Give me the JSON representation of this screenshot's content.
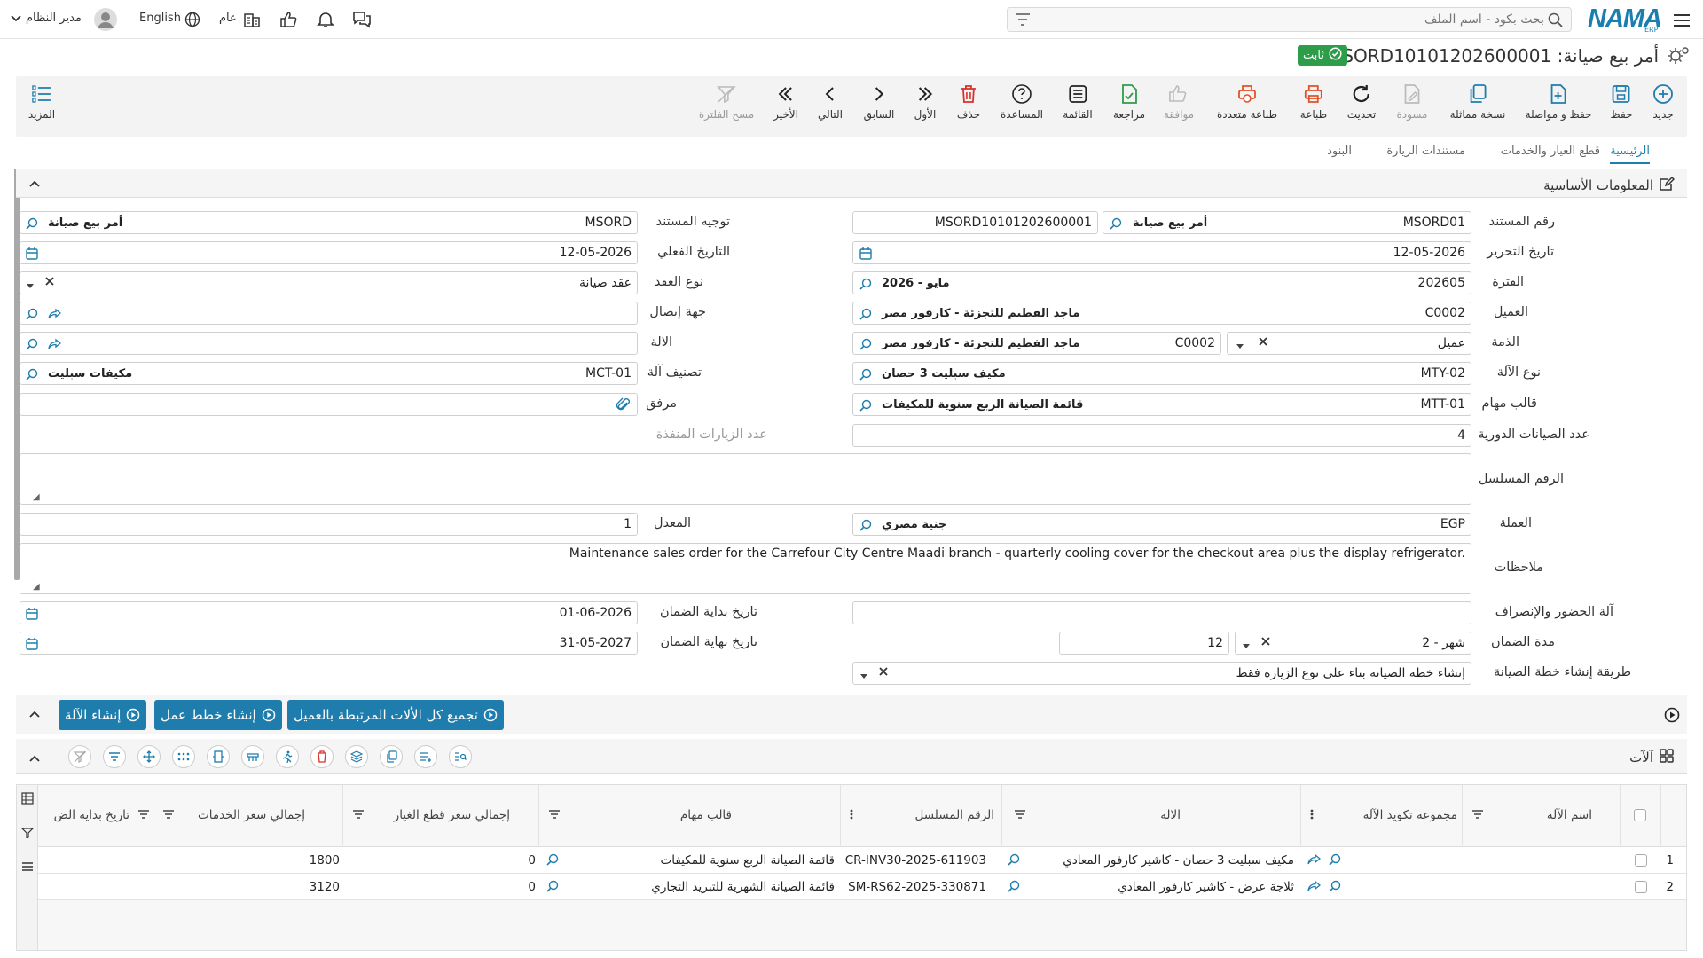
{
  "topbar": {
    "search_placeholder": "بحث بكود - اسم الملف",
    "user_name": "مدير النظام",
    "language": "English",
    "scope": "عام",
    "brand": "NAMA",
    "brand_sub": "ERP"
  },
  "page": {
    "title": "أمر بيع صيانة: MSORD10101202600001",
    "status": "ثابت"
  },
  "toolbar": {
    "new": "جديد",
    "save": "حفظ",
    "save_continue": "حفظ و مواصلة",
    "copy_similar": "نسخة مماثلة",
    "draft": "مسودة",
    "refresh": "تحديث",
    "print": "طباعة",
    "multi_print": "طباعة متعددة",
    "approve": "موافقة",
    "review": "مراجعة",
    "list": "القائمة",
    "help": "المساعدة",
    "delete": "حذف",
    "first": "الأول",
    "previous": "السابق",
    "next": "التالي",
    "last": "الأخير",
    "clear_filter": "مسح الفلترة",
    "more": "المزيد"
  },
  "tabs": [
    "الرئيسية",
    "قطع الغيار والخدمات",
    "مستندات الزيارة",
    "البنود"
  ],
  "section_basic": "المعلومات الأساسية",
  "fields": {
    "doc_number": {
      "label": "رقم المستند",
      "code": "MSORD01",
      "name": "أمر بيع صيانة",
      "value": "MSORD10101202600001"
    },
    "doc_direction": {
      "label": "توجيه المستند",
      "code": "MSORD",
      "name": "أمر بيع صيانة"
    },
    "issue_date": {
      "label": "تاريخ التحرير",
      "value": "12-05-2026"
    },
    "actual_date": {
      "label": "التاريخ الفعلي",
      "value": "12-05-2026"
    },
    "period": {
      "label": "الفترة",
      "code": "202605",
      "name": "2026 - مايو"
    },
    "contract_type": {
      "label": "نوع العقد",
      "value": "عقد صيانة"
    },
    "customer": {
      "label": "العميل",
      "code": "C0002",
      "name": "ماجد الفطيم للتجزئة - كارفور مصر"
    },
    "contact": {
      "label": "جهة إتصال",
      "value": ""
    },
    "account": {
      "label": "الذمة",
      "type": "عميل",
      "code": "C0002",
      "name": "ماجد الفطيم للتجزئة - كارفور مصر"
    },
    "machine": {
      "label": "الالة",
      "value": ""
    },
    "machine_type": {
      "label": "نوع الآلة",
      "code": "MTY-02",
      "name": "مكيف سبليت 3 حصان"
    },
    "machine_class": {
      "label": "تصنيف آلة",
      "code": "MCT-01",
      "name": "مكيفات سبليت"
    },
    "task_template": {
      "label": "قالب مهام",
      "code": "MTT-01",
      "name": "قائمة الصيانة الربع سنوية للمكيفات"
    },
    "attachment": {
      "label": "مرفق",
      "value": ""
    },
    "periodic_count": {
      "label": "عدد الصيانات الدورية",
      "value": "4"
    },
    "executed_visits": {
      "label": "عدد الزيارات المنفذة",
      "value": ""
    },
    "serial": {
      "label": "الرقم المسلسل",
      "value": ""
    },
    "currency": {
      "label": "العملة",
      "code": "EGP",
      "name": "جنية مصري"
    },
    "rate": {
      "label": "المعدل",
      "value": "1"
    },
    "notes": {
      "label": "ملاحظات",
      "value": "Maintenance sales order for the Carrefour City Centre Maadi branch - quarterly cooling cover for the checkout area plus the display refrigerator."
    },
    "attendance_machine": {
      "label": "آلة الحضور والإنصراف",
      "value": ""
    },
    "warranty_start": {
      "label": "تاريخ بداية الضمان",
      "value": "01-06-2026"
    },
    "warranty_period": {
      "label": "مدة الضمان",
      "unit": "2 - شهر",
      "value": "12"
    },
    "warranty_end": {
      "label": "تاريخ نهاية الضمان",
      "value": "31-05-2027"
    },
    "plan_method": {
      "label": "طريقة إنشاء خطة الصيانة",
      "value": "إنشاء خطة الصيانة بناء على نوع الزيارة فقط"
    }
  },
  "actions": {
    "collect_machines": "تجميع كل الألات المرتبطة بالعميل",
    "create_work_plans": "إنشاء خطط عمل",
    "create_machine": "إنشاء الآلة"
  },
  "section_machines": "آلآت",
  "grid": {
    "columns": [
      "اسم الآلة",
      "مجموعة تكويد الآلة",
      "الالة",
      "الرقم المسلسل",
      "قالب مهام",
      "إجمالي سعر قطع الغيار",
      "إجمالي سعر الخدمات",
      "تاريخ بداية الض"
    ],
    "rows": [
      {
        "num": "1",
        "machine": "مكيف سبليت 3 حصان - كاشير كارفور المعادي",
        "serial": "CR-INV30-2025-611903",
        "template": "قائمة الصيانة الربع سنوية للمكيفات",
        "parts": "0",
        "services": "1800"
      },
      {
        "num": "2",
        "machine": "ثلاجة عرض - كاشير كارفور المعادي",
        "serial": "SM-RS62-2025-330871",
        "template": "قائمة الصيانة الشهرية للتبريد التجاري",
        "parts": "0",
        "services": "3120"
      }
    ]
  },
  "colors": {
    "accent": "#1e7dad",
    "status_green": "#2e9d4a",
    "print_red": "#e0522a",
    "delete_red": "#d9302c"
  }
}
